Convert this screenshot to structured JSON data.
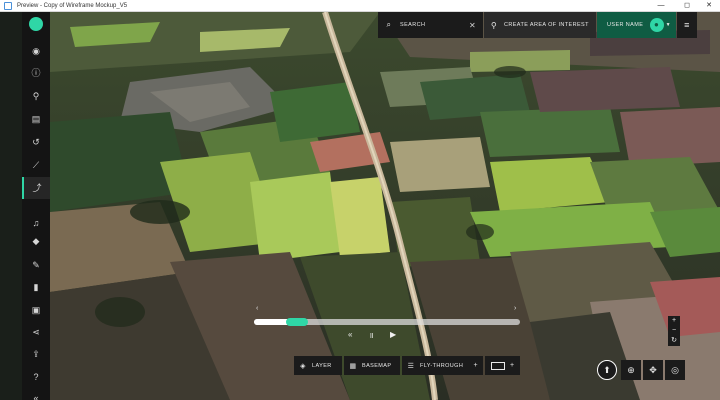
{
  "window": {
    "title": "Preview - Copy of Wireframe Mockup_V5",
    "minimize_glyph": "—",
    "maximize_glyph": "◻",
    "close_glyph": "✕"
  },
  "sidebar": {
    "items": [
      {
        "name": "globe-icon",
        "glyph": "◉"
      },
      {
        "name": "info-icon",
        "glyph": "ⓘ"
      },
      {
        "name": "map-pin-icon",
        "glyph": "⚲"
      },
      {
        "name": "layers-icon",
        "glyph": "▤"
      },
      {
        "name": "history-icon",
        "glyph": "↺"
      },
      {
        "name": "ruler-icon",
        "glyph": "⟋"
      },
      {
        "name": "analytics-icon",
        "glyph": "⤴"
      },
      {
        "name": "bell-icon",
        "glyph": "♫"
      },
      {
        "name": "tag-icon",
        "glyph": "◆"
      },
      {
        "name": "edit-icon",
        "glyph": "✎"
      },
      {
        "name": "bookmark-icon",
        "glyph": "▮"
      },
      {
        "name": "image-icon",
        "glyph": "▣"
      },
      {
        "name": "share-icon",
        "glyph": "⋖"
      },
      {
        "name": "export-icon",
        "glyph": "⇪"
      },
      {
        "name": "help-icon",
        "glyph": "?"
      },
      {
        "name": "collapse-icon",
        "glyph": "«"
      }
    ],
    "active_index": 6,
    "accent": "#2fd6a6"
  },
  "topbar": {
    "search_label": "SEARCH",
    "search_icon": "⌕",
    "clear_glyph": "✕",
    "aoi_label": "CREATE AREA OF INTEREST",
    "aoi_icon": "⚲",
    "user_label": "USER NAME",
    "user_avatar": "●",
    "user_caret": "▼",
    "menu_glyph": "≡"
  },
  "timeline": {
    "progress": 0.05,
    "prev_glyph": "‹",
    "next_glyph": "›",
    "rewind_glyph": "«",
    "pause_glyph": "॥",
    "play_glyph": "▶"
  },
  "toolbar": {
    "layer_label": "LAYER",
    "layer_icon": "◈",
    "basemap_label": "BASEMAP",
    "basemap_icon": "▦",
    "fly_label": "FLY-THROUGH",
    "fly_icon": "☰",
    "plus_glyph": "+"
  },
  "map_controls": {
    "zoom_in": "+",
    "zoom_out": "−",
    "rotate": "↻",
    "compass": "⬆",
    "zoom_tool": "⊕",
    "pan_tool": "✥",
    "target_tool": "◎"
  },
  "colors": {
    "brand": "#2fd6a6",
    "user_bg": "#0f5c43"
  }
}
